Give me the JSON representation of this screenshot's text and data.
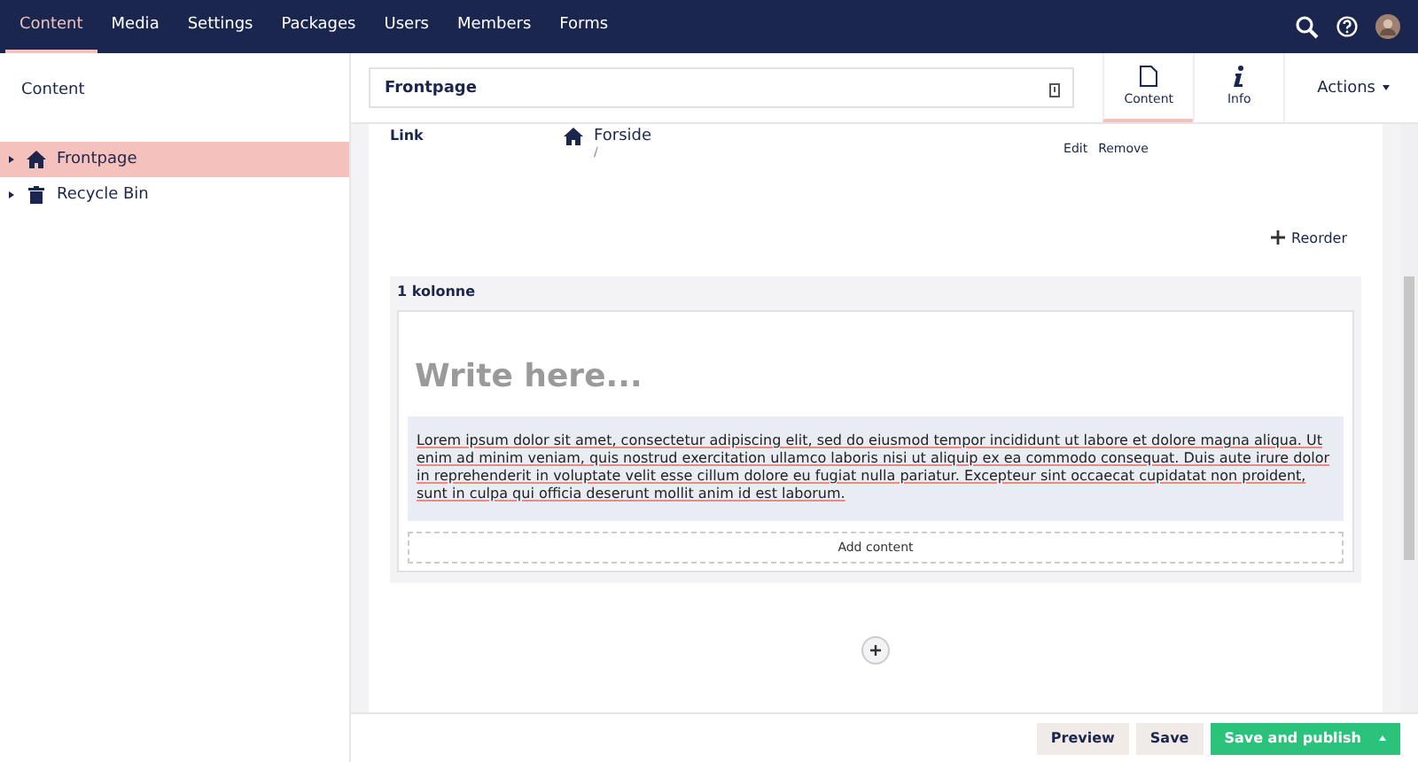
{
  "nav": [
    {
      "label": "Content",
      "selected": true
    },
    {
      "label": "Media",
      "selected": false
    },
    {
      "label": "Settings",
      "selected": false
    },
    {
      "label": "Packages",
      "selected": false
    },
    {
      "label": "Users",
      "selected": false
    },
    {
      "label": "Members",
      "selected": false
    },
    {
      "label": "Forms",
      "selected": false
    }
  ],
  "sidebar": {
    "title": "Content",
    "items": [
      {
        "label": "Frontpage",
        "kind": "home",
        "selected": true
      },
      {
        "label": "Recycle Bin",
        "kind": "trash",
        "selected": false
      }
    ]
  },
  "header": {
    "name": "Frontpage",
    "tabs": [
      {
        "label": "Content",
        "kind": "page",
        "selected": true
      },
      {
        "label": "Info",
        "kind": "info",
        "selected": false
      }
    ],
    "actions": "Actions"
  },
  "link": {
    "label": "Link",
    "title": "Forside",
    "url": "/",
    "edit": "Edit",
    "remove": "Remove"
  },
  "reorder": "Reorder",
  "grid": {
    "title": "1 kolonne",
    "placeholder": "Write here...",
    "text": "Lorem ipsum dolor sit amet, consectetur adipiscing elit, sed do eiusmod tempor incididunt ut labore et dolore magna aliqua. Ut enim ad minim veniam, quis nostrud exercitation ullamco laboris nisi ut aliquip ex ea commodo consequat. Duis aute irure dolor in reprehenderit in voluptate velit esse cillum dolore eu fugiat nulla pariatur. Excepteur sint occaecat cupidatat non proident, sunt in culpa qui officia deserunt mollit anim id est laborum.",
    "add": "Add content"
  },
  "footer": {
    "buttons": [
      {
        "label": "Preview",
        "kind": "secondary"
      },
      {
        "label": "Save",
        "kind": "secondary"
      },
      {
        "label": "Save and publish",
        "kind": "primary"
      }
    ]
  }
}
